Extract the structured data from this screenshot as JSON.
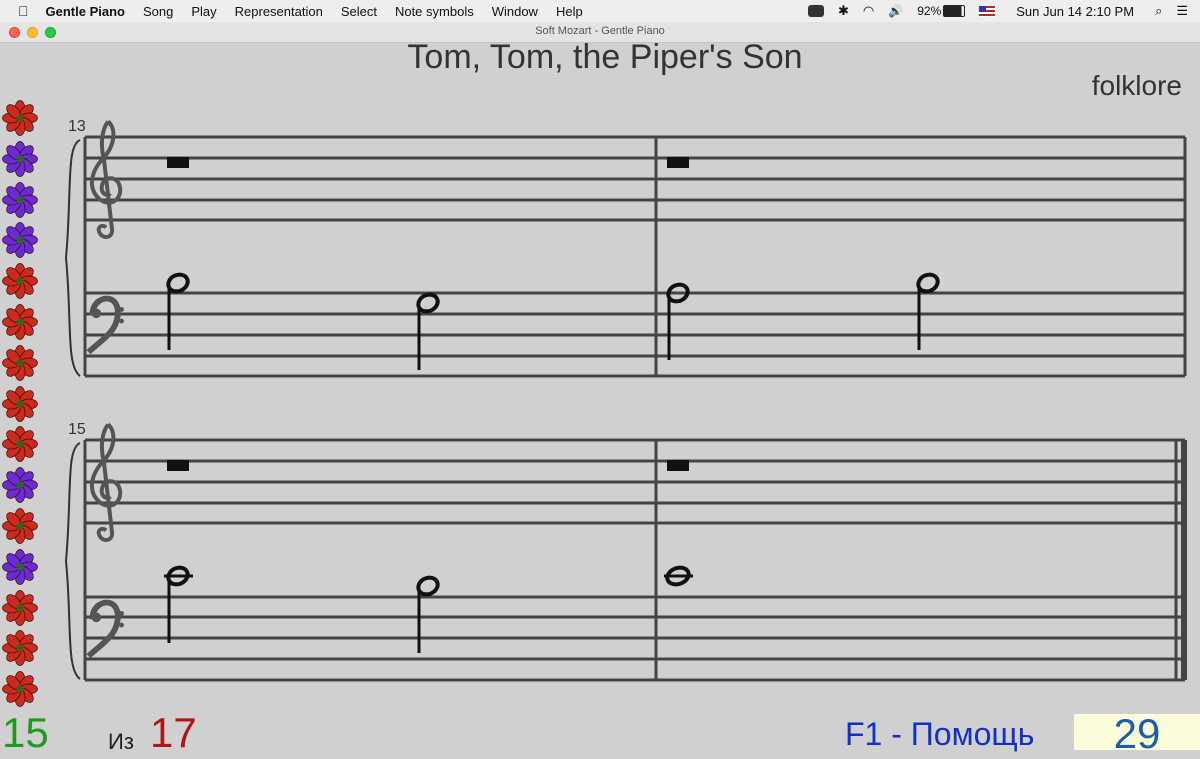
{
  "menubar": {
    "app_name": "Gentle Piano",
    "items": [
      "Song",
      "Play",
      "Representation",
      "Select",
      "Note symbols",
      "Window",
      "Help"
    ],
    "battery": "92%",
    "clock": "Sun Jun 14  2:10 PM"
  },
  "window": {
    "title": "Soft Mozart - Gentle Piano"
  },
  "song": {
    "title": "Tom, Tom, the Piper's Son",
    "composer": "folklore"
  },
  "systems": [
    {
      "measure_number": "13"
    },
    {
      "measure_number": "15"
    }
  ],
  "flowers": [
    "red",
    "purple",
    "purple",
    "purple",
    "red",
    "red",
    "red",
    "red",
    "red",
    "purple",
    "red",
    "purple",
    "red",
    "red",
    "red"
  ],
  "colors": {
    "red_flower": "#cc2a1c",
    "purple_flower": "#6a2ad6",
    "green_text": "#1f9a1f",
    "red_text": "#b01515",
    "blue_text": "#1030c8",
    "score_box": "#fbfbd8"
  },
  "footer": {
    "current": "15",
    "of_label": "Из",
    "total": "17",
    "help": "F1 - Помощь",
    "score": "29"
  }
}
